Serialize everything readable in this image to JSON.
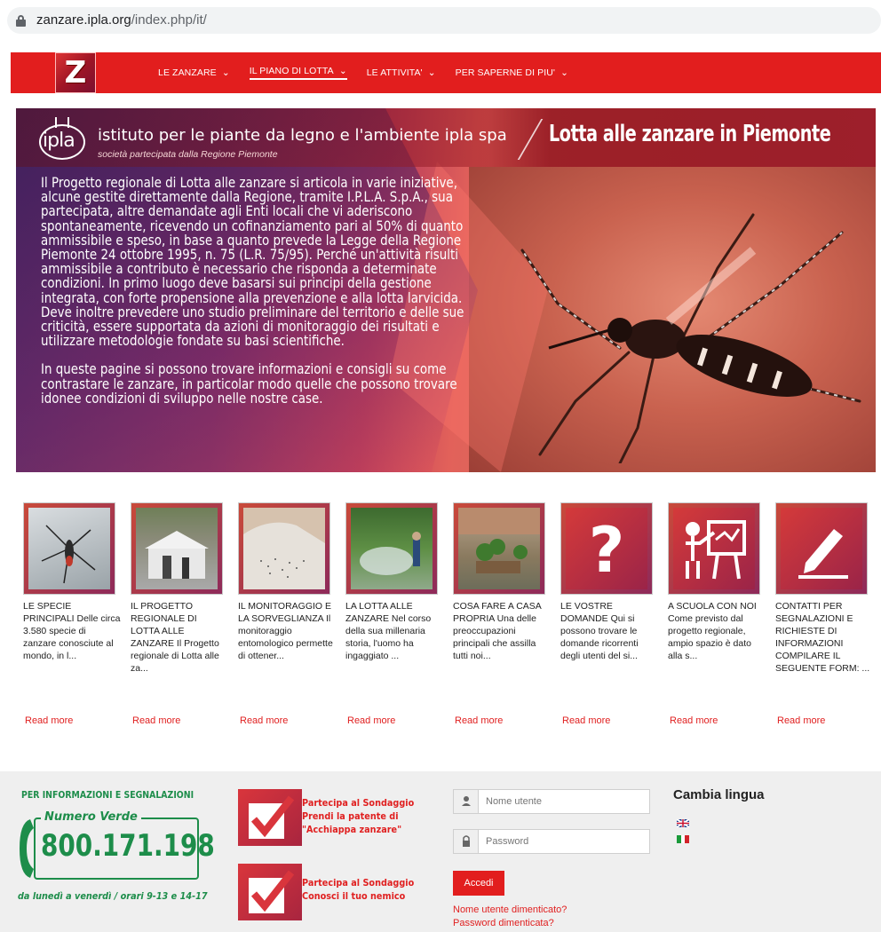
{
  "browser": {
    "url_domain": "zanzare.ipla.org",
    "url_path": "/index.php/it/"
  },
  "nav": {
    "logo_letter": "Z",
    "items": [
      {
        "label": "LE ZANZARE",
        "caret": "⌄",
        "active": false
      },
      {
        "label": "IL PIANO DI LOTTA",
        "caret": "⌄",
        "active": true
      },
      {
        "label": "LE ATTIVITA'",
        "caret": "⌄",
        "active": false
      },
      {
        "label": "PER SAPERNE DI PIU'",
        "caret": "⌄",
        "active": false
      }
    ]
  },
  "banner": {
    "logo_text": "ipla",
    "org_name": "istituto per le piante da legno e l'ambiente ipla spa",
    "org_sub": "società partecipata dalla Regione Piemonte",
    "headline": "Lotta alle zanzare in Piemonte",
    "paragraphs": [
      "Il Progetto regionale di Lotta alle zanzare si articola in varie iniziative, alcune gestite direttamente dalla Regione, tramite I.P.L.A. S.p.A., sua partecipata, altre demandate agli Enti locali che vi aderiscono spontaneamente, ricevendo un cofinanziamento pari al 50% di quanto ammissibile e speso, in base a quanto prevede la Legge della Regione Piemonte 24 ottobre 1995, n. 75 (L.R. 75/95). Perché un'attività risulti ammissibile a contributo è necessario che risponda a determinate condizioni. In primo luogo deve basarsi sui principi della gestione integrata, con forte propensione alla prevenzione e alla lotta larvicida. Deve inoltre prevedere uno studio preliminare del territorio e delle sue criticità, essere supportata da azioni di monitoraggio dei risultati e utilizzare metodologie fondate su basi scientifiche.",
      "In queste pagine si possono trovare informazioni e consigli su come contrastare le zanzare, in particolar modo quelle che possono trovare idonee condizioni di sviluppo nelle nostre case."
    ]
  },
  "cards": [
    {
      "text": "LE SPECIE PRINCIPALI Delle circa 3.580 specie di zanzare conosciute al mondo, in l...",
      "read_more": "Read more",
      "thumb": "mosquito-photo"
    },
    {
      "text": "IL PROGETTO REGIONALE DI LOTTA ALLE ZANZARE Il Progetto regionale di Lotta alle za...",
      "read_more": "Read more",
      "thumb": "gazebo-photo"
    },
    {
      "text": "IL MONITORAGGIO E LA SORVEGLIANZA Il monitoraggio entomologico permette di ottener...",
      "read_more": "Read more",
      "thumb": "lab-sample-photo"
    },
    {
      "text": "LA LOTTA ALLE ZANZARE Nel corso della sua millenaria storia, l'uomo ha ingaggiato ...",
      "read_more": "Read more",
      "thumb": "spraying-photo"
    },
    {
      "text": "COSA FARE A CASA PROPRIA Una delle preoccupazioni principali che assilla tutti noi...",
      "read_more": "Read more",
      "thumb": "garden-photo"
    },
    {
      "text": "LE VOSTRE DOMANDE Qui si possono trovare le domande ricorrenti degli utenti del si...",
      "read_more": "Read more",
      "thumb": "question-icon"
    },
    {
      "text": "A SCUOLA CON NOI Come previsto dal progetto regionale, ampio spazio è dato alla s...",
      "read_more": "Read more",
      "thumb": "teacher-board-icon"
    },
    {
      "text": "CONTATTI PER SEGNALAZIONI E RICHIESTE DI INFORMAZIONI COMPILARE IL SEGUENTE FORM: ...",
      "read_more": "Read more",
      "thumb": "pencil-form-icon"
    }
  ],
  "footer": {
    "info_title": "PER INFORMAZIONI E SEGNALAZIONI",
    "numero_verde_label": "Numero Verde",
    "phone": "800.171.198",
    "hours": "da lunedì a venerdì / orari 9-13 e 14-17",
    "surveys": [
      {
        "line1": "Partecipa al Sondaggio",
        "line2": "Prendi la patente di",
        "line3": "\"Acchiappa zanzare\""
      },
      {
        "line1": "Partecipa al Sondaggio",
        "line2": "Conosci il tuo nemico",
        "line3": ""
      }
    ],
    "login": {
      "username_placeholder": "Nome utente",
      "password_placeholder": "Password",
      "submit": "Accedi",
      "forgot_username": "Nome utente dimenticato?",
      "forgot_password": "Password dimenticata?"
    },
    "language": {
      "title": "Cambia lingua",
      "flags": [
        "en-flag",
        "it-flag"
      ]
    }
  },
  "colors": {
    "nav_red": "#e21e1e",
    "link_red": "#e02020",
    "green": "#1d8d4a"
  }
}
